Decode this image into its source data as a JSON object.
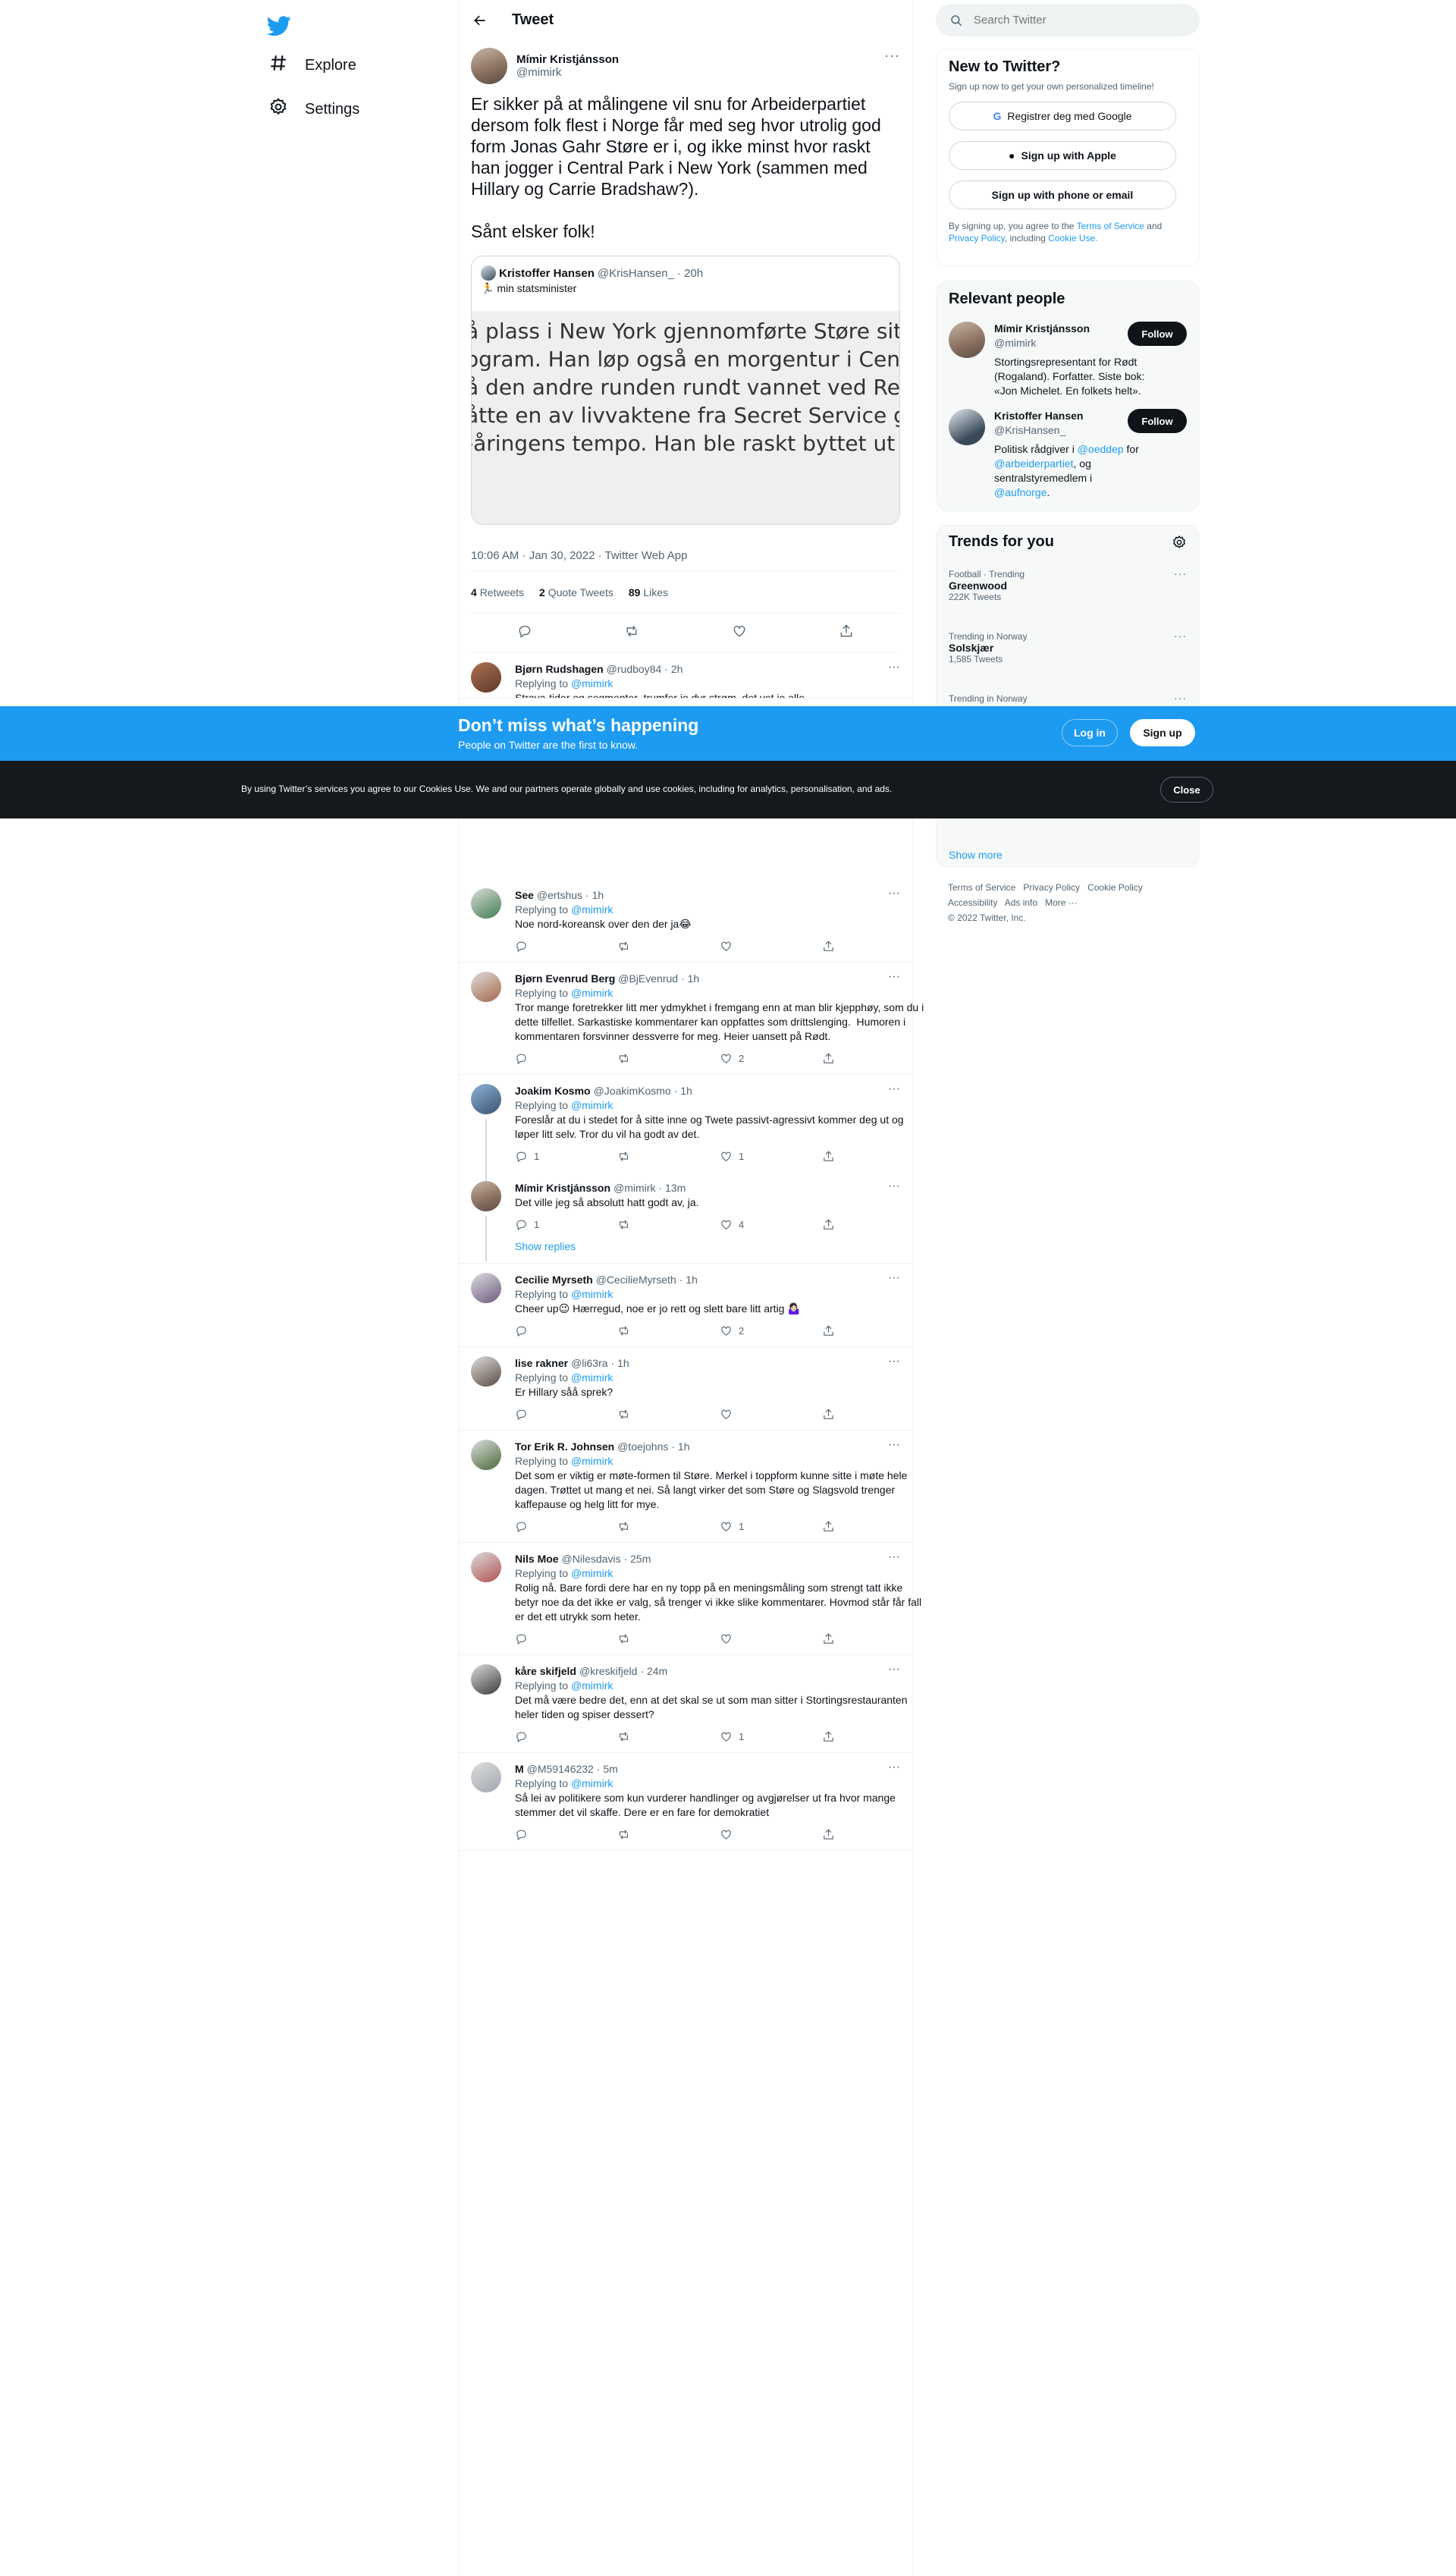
{
  "nav": {
    "explore": "Explore",
    "settings": "Settings"
  },
  "header": {
    "title": "Tweet"
  },
  "tweet": {
    "name": "Mímir Kristjánsson",
    "handle": "@mimirk",
    "text": "Er sikker på at målingene vil snu for Arbeiderpartiet dersom folk flest i Norge får med seg hvor utrolig god form Jonas Gahr Støre er i, og ikke minst hvor raskt han jogger i Central Park i New York (sammen med Hillary og Carrie Bradshaw?).\n\nSånt elsker folk!",
    "quote": {
      "name": "Kristoffer Hansen",
      "handle": "@KrisHansen_",
      "time": "· 20h",
      "text": "min statsminister",
      "image_lines": [
        "å plass i New York gjennomførte Støre sitt fastsatt",
        "ogram. Han løp også en morgentur i Central Park",
        "å den andre runden rundt vannet ved Reservoir",
        "åtte en av livvaktene fra Secret Service gi tapt for",
        "-åringens tempo. Han ble raskt byttet ut med en",
        "."
      ]
    },
    "meta": "10:06 AM · Jan 30, 2022 · Twitter Web App",
    "retweets": "4",
    "retweets_label": "Retweets",
    "quotes": "2",
    "quotes_label": "Quote Tweets",
    "likes": "89",
    "likes_label": "Likes"
  },
  "replies_top": [
    {
      "name": "Bjørn Rudshagen",
      "handle": "@rudboy84",
      "time": "· 2h",
      "replying": "Replying to",
      "to": "@mimirk",
      "text": "Strava-tider og segmenter  trumfer jo dyr strøm, det vet jo alle"
    }
  ],
  "replies": [
    {
      "name": "See",
      "handle": "@ertshus",
      "time": "· 1h",
      "replying": "Replying to",
      "to": "@mimirk",
      "text": "Noe nord-koreansk over den der ja😂",
      "likes": ""
    },
    {
      "name": "Bjørn Evenrud Berg",
      "handle": "@BjEvenrud",
      "time": "· 1h",
      "replying": "Replying to",
      "to": "@mimirk",
      "text": "Tror mange foretrekker litt mer ydmykhet i fremgang enn at man blir kjepphøy, som du i dette tilfellet. Sarkastiske kommentarer kan oppfattes som drittslenging.  Humoren i kommentaren forsvinner dessverre for meg. Heier uansett på Rødt.",
      "likes": "2"
    }
  ],
  "thread": [
    {
      "name": "Joakim Kosmo",
      "handle": "@JoakimKosmo",
      "time": "· 1h",
      "replying": "Replying to",
      "to": "@mimirk",
      "text": "Foreslår at du i stedet for å sitte inne og Twete passivt-agressivt kommer deg ut og løper litt selv. Tror du vil ha godt av det.",
      "replies": "1",
      "likes": "1"
    },
    {
      "name": "Mímir Kristjánsson",
      "handle": "@mimirk",
      "time": "· 13m",
      "text": "Det ville jeg så absolutt hatt godt av, ja.",
      "replies": "1",
      "likes": "4"
    }
  ],
  "show_replies": "Show replies",
  "replies_after": [
    {
      "name": "Cecilie Myrseth",
      "handle": "@CecilieMyrseth",
      "time": "· 1h",
      "replying": "Replying to",
      "to": "@mimirk",
      "text": "Cheer up😉 Hærregud, noe er jo rett og slett bare litt artig 🤷🏻‍♀️",
      "likes": "2"
    },
    {
      "name": "lise rakner",
      "handle": "@li63ra",
      "time": "· 1h",
      "replying": "Replying to",
      "to": "@mimirk",
      "text": "Er Hillary såå sprek?",
      "likes": ""
    },
    {
      "name": "Tor Erik R. Johnsen",
      "handle": "@toejohns",
      "time": "· 1h",
      "replying": "Replying to",
      "to": "@mimirk",
      "text": "Det som er viktig er møte-formen til Støre. Merkel i toppform kunne sitte i møte hele dagen. Trøttet ut mang et nei. Så langt virker det som Støre og Slagsvold trenger kaffepause og helg litt for mye.",
      "likes": "1"
    },
    {
      "name": "Nils Moe",
      "handle": "@Nilesdavis",
      "time": "· 25m",
      "replying": "Replying to",
      "to": "@mimirk",
      "text": "Rolig nå. Bare fordi dere har en ny topp på en meningsmåling som strengt tatt ikke betyr noe da det ikke er valg, så trenger vi ikke slike kommentarer. Hovmod står får fall er det ett utrykk som heter.",
      "likes": ""
    },
    {
      "name": "kåre skifjeld",
      "handle": "@kreskifjeld",
      "time": "· 24m",
      "replying": "Replying to",
      "to": "@mimirk",
      "text": "Det må være bedre det, enn at det skal se ut som man sitter i Stortingsrestauranten heler tiden og spiser dessert?",
      "likes": "1"
    },
    {
      "name": "M",
      "handle": "@M59146232",
      "time": "· 5m",
      "replying": "Replying to",
      "to": "@mimirk",
      "text": "Så lei av politikere som kun vurderer handlinger og avgjørelser ut fra hvor mange stemmer det vil skaffe. Dere er en fare for demokratiet",
      "likes": ""
    }
  ],
  "sidebar": {
    "search_placeholder": "Search Twitter",
    "new": {
      "title": "New to Twitter?",
      "subtitle": "Sign up now to get your own personalized timeline!",
      "google": "Registrer deg med Google",
      "apple": "Sign up with Apple",
      "phone": "Sign up with phone or email",
      "legal_1": "By signing up, you agree to the",
      "tos": "Terms of Service",
      "and": "and",
      "privacy": "Privacy Policy",
      "including": ", including",
      "cookie": "Cookie Use."
    },
    "relevant": {
      "title": "Relevant people",
      "follow": "Follow",
      "people": [
        {
          "name": "Mímir Kristjánsson",
          "handle": "@mimirk",
          "bio": "Stortingsrepresentant for Rødt (Rogaland). Forfatter. Siste bok: «Jon Michelet. En folkets helt»."
        },
        {
          "name": "Kristoffer Hansen",
          "handle": "@KrisHansen_",
          "bio_1": "Politisk rådgiver i",
          "mention_1": "@oeddep",
          "bio_2": "for",
          "mention_2": "@arbeiderpartiet",
          "bio_3": ", og sentralstyremedlem i",
          "mention_3": "@aufnorge",
          "bio_4": "."
        }
      ]
    },
    "trends": {
      "title": "Trends for you",
      "items": [
        {
          "context": "Football · Trending",
          "name": "Greenwood",
          "count": "222K Tweets"
        },
        {
          "context": "Trending in Norway",
          "name": "Solskjær",
          "count": "1,585 Tweets"
        },
        {
          "context": "Trending in Norway",
          "name": "",
          "count": ""
        }
      ],
      "show_more": "Show more"
    },
    "footer": {
      "links": [
        "Terms of Service",
        "Privacy Policy",
        "Cookie Policy",
        "Accessibility",
        "Ads info",
        "More ···"
      ],
      "copyright": "© 2022 Twitter, Inc."
    }
  },
  "banner": {
    "title": "Don’t miss what’s happening",
    "subtitle": "People on Twitter are the first to know.",
    "login": "Log in",
    "signup": "Sign up"
  },
  "cookies": {
    "text": "By using Twitter’s services you agree to our Cookies Use. We and our partners operate globally and use cookies, including for analytics, personalisation, and ads.",
    "close": "Close"
  },
  "colors": {
    "accent": "#1d9bf0",
    "text": "#0f1419",
    "muted": "#536471",
    "dark": "#15181c"
  }
}
